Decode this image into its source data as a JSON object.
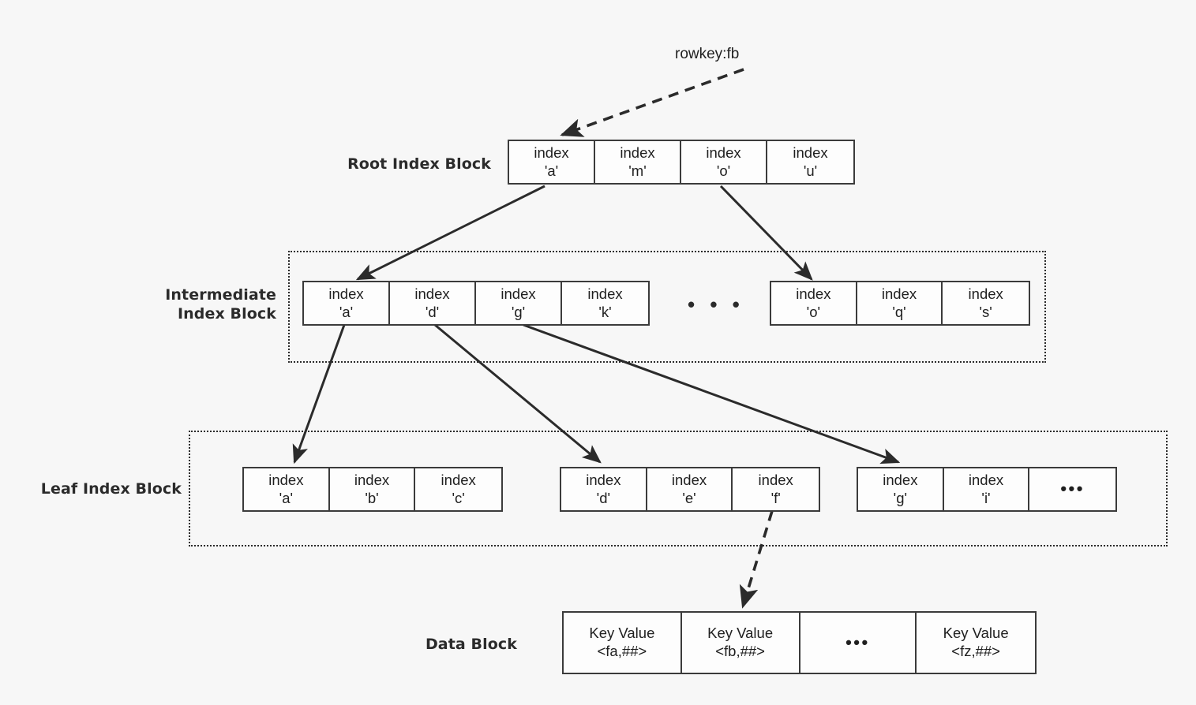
{
  "diagram": {
    "title_note": "rowkey:fb",
    "background": "#f7f7f7",
    "stroke": "#3b3b3b",
    "rows": [
      {
        "id": "root",
        "label": "Root Index Block",
        "cells": [
          {
            "l1": "index",
            "l2": "'a'"
          },
          {
            "l1": "index",
            "l2": "'m'"
          },
          {
            "l1": "index",
            "l2": "'o'"
          },
          {
            "l1": "index",
            "l2": "'u'"
          }
        ]
      },
      {
        "id": "intermediate",
        "label": "Intermediate\nIndex Block",
        "group_a": [
          {
            "l1": "index",
            "l2": "'a'"
          },
          {
            "l1": "index",
            "l2": "'d'"
          },
          {
            "l1": "index",
            "l2": "'g'"
          },
          {
            "l1": "index",
            "l2": "'k'"
          }
        ],
        "gap_ellipsis": "• • •",
        "group_b": [
          {
            "l1": "index",
            "l2": "'o'"
          },
          {
            "l1": "index",
            "l2": "'q'"
          },
          {
            "l1": "index",
            "l2": "'s'"
          }
        ]
      },
      {
        "id": "leaf",
        "label": "Leaf Index Block",
        "group_a": [
          {
            "l1": "index",
            "l2": "'a'"
          },
          {
            "l1": "index",
            "l2": "'b'"
          },
          {
            "l1": "index",
            "l2": "'c'"
          }
        ],
        "group_b": [
          {
            "l1": "index",
            "l2": "'d'"
          },
          {
            "l1": "index",
            "l2": "'e'"
          },
          {
            "l1": "index",
            "l2": "'f'"
          }
        ],
        "group_c": [
          {
            "l1": "index",
            "l2": "'g'"
          },
          {
            "l1": "index",
            "l2": "'i'"
          },
          {
            "l1": "•••",
            "l2": ""
          }
        ]
      },
      {
        "id": "data",
        "label": "Data Block",
        "cells": [
          {
            "l1": "Key Value",
            "l2": "<fa,##>"
          },
          {
            "l1": "Key Value",
            "l2": "<fb,##>"
          },
          {
            "l1": "•••",
            "l2": ""
          },
          {
            "l1": "Key Value",
            "l2": "<fz,##>"
          }
        ]
      }
    ]
  }
}
